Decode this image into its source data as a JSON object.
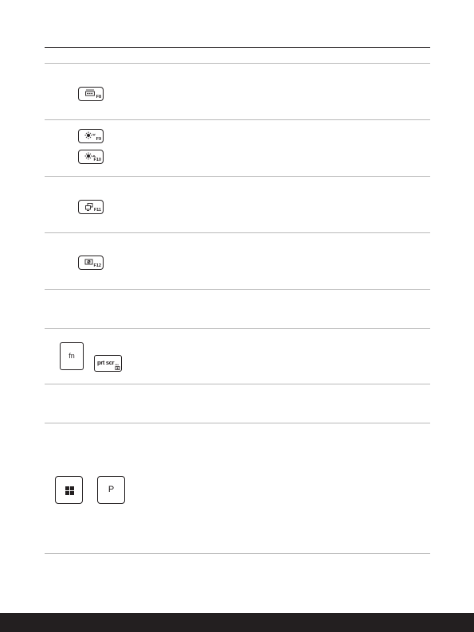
{
  "keys": {
    "f8": {
      "label": "F8",
      "icon": "keyboard-backlight-icon"
    },
    "f9": {
      "label": "F9",
      "icon": "brightness-down-icon"
    },
    "f10": {
      "label": "F10",
      "icon": "brightness-up-icon"
    },
    "f11": {
      "label": "F11",
      "icon": "display-switch-icon"
    },
    "f12": {
      "label": "F12",
      "icon": "touchpad-toggle-icon"
    },
    "fn": {
      "label": "fn"
    },
    "prtscr": {
      "label": "prt scr",
      "sub": "ins",
      "icon": "screenshot-icon"
    },
    "windows": {
      "icon": "windows-logo-icon"
    },
    "p": {
      "label": "P"
    }
  },
  "colors": {
    "ink": "#231f20",
    "rule": "#b8b8b8",
    "footer": "#231f20"
  }
}
